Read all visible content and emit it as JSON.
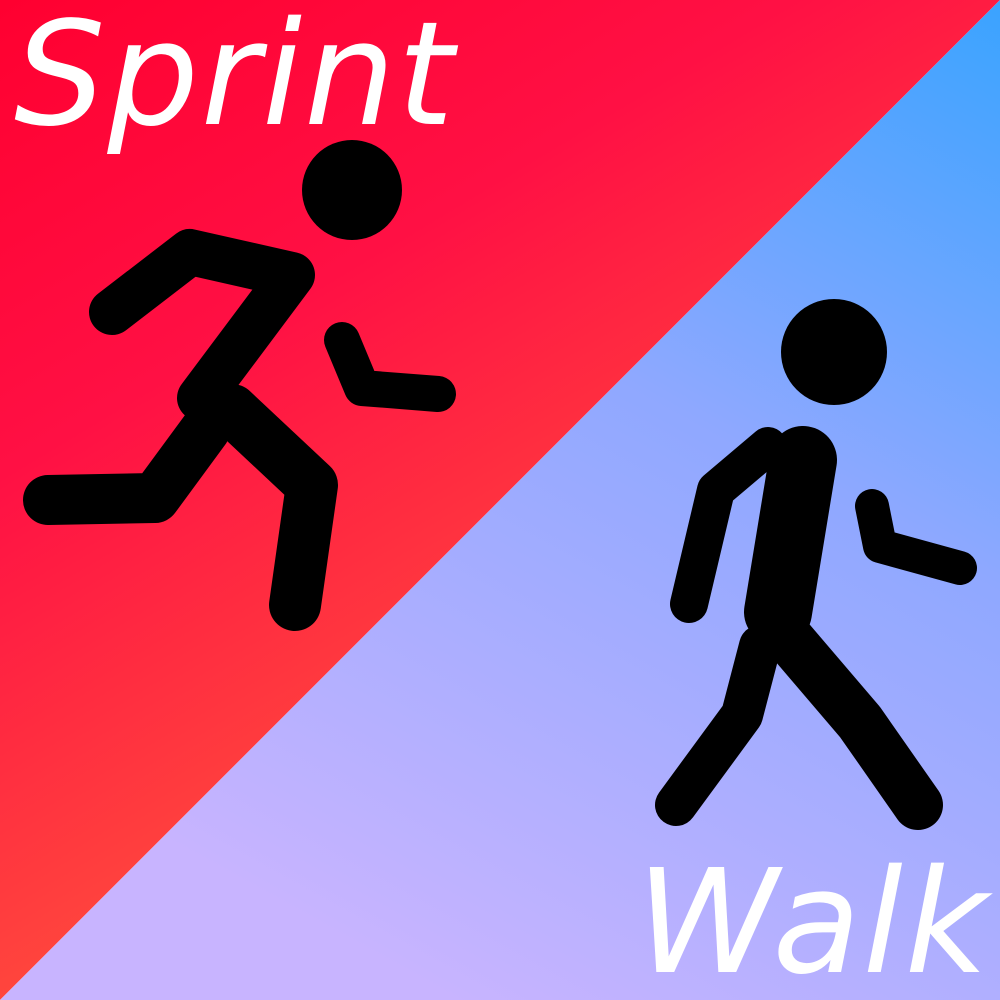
{
  "titles": {
    "top_left": "Sprint",
    "bottom_right": "Walk"
  },
  "icons": {
    "runner": "running-person-icon",
    "walker": "walking-person-icon"
  },
  "colors": {
    "sprint_red": "#ff0030",
    "sprint_orange": "#ff6a38",
    "walk_blue": "#3aa3ff",
    "walk_lavender": "#c8b4ff",
    "figure": "#000000",
    "text": "#ffffff"
  }
}
